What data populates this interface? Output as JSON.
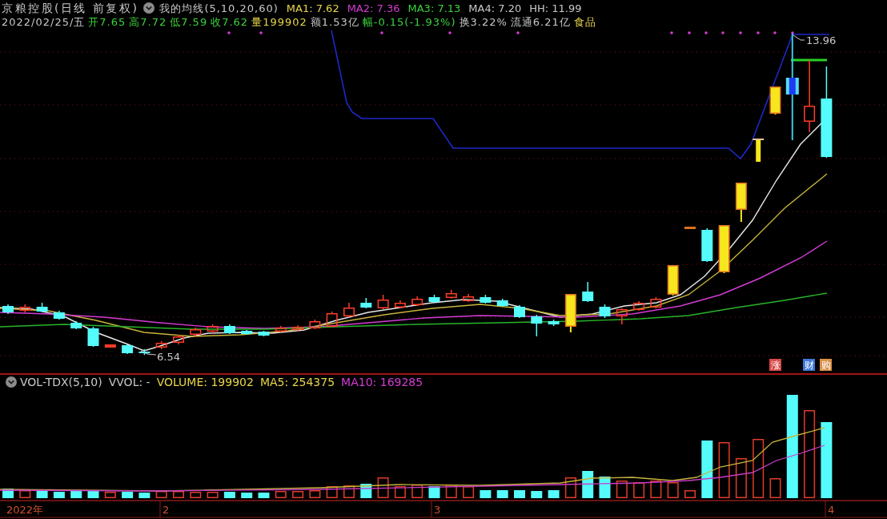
{
  "header": {
    "title": "京粮控股(日线 前复权)",
    "indicator": "我的均线(5,10,20,60)",
    "values": [
      {
        "text": "MA1: 7.62",
        "color": "#e8d64a"
      },
      {
        "text": "MA2: 7.36",
        "color": "#d43cd4"
      },
      {
        "text": "MA3: 7.13",
        "color": "#3cd23c"
      },
      {
        "text": "MA4: 7.20",
        "color": "#c8c8c8"
      },
      {
        "text": "HH: 11.99",
        "color": "#c8c8c8"
      }
    ]
  },
  "quote": {
    "date": "2022/02/25/五",
    "fields": [
      {
        "text": "开7.65",
        "color": "#3cd23c"
      },
      {
        "text": "高7.72",
        "color": "#3cd23c"
      },
      {
        "text": "低7.59",
        "color": "#3cd23c"
      },
      {
        "text": "收7.62",
        "color": "#3cd23c"
      },
      {
        "text": "量199902",
        "color": "#e8d64a"
      },
      {
        "text": "额1.53亿",
        "color": "#c8c8c8"
      },
      {
        "text": "幅-0.15(-1.93%)",
        "color": "#3cd23c"
      },
      {
        "text": "换3.22%",
        "color": "#c8c8c8"
      },
      {
        "text": "流通6.21亿",
        "color": "#c8c8c8"
      },
      {
        "text": "食品",
        "color": "#e8d64a"
      }
    ]
  },
  "price_chart": {
    "high_label": "13.96",
    "low_label": "6.54",
    "markers": [
      {
        "text": "涨",
        "color": "#d84848"
      },
      {
        "text": "财",
        "color": "#3c78d8"
      },
      {
        "text": "购",
        "color": "#d89048"
      }
    ]
  },
  "volume_panel": {
    "indicator": "VOL-TDX(5,10)",
    "values": [
      {
        "text": "VVOL: -",
        "color": "#c8c8c8"
      },
      {
        "text": "VOLUME: 199902",
        "color": "#e8d64a"
      },
      {
        "text": "MA5: 254375",
        "color": "#e8d64a"
      },
      {
        "text": "MA10: 169285",
        "color": "#d43cd4"
      }
    ]
  },
  "time_axis": [
    {
      "label": "2022年"
    },
    {
      "label": "2"
    },
    {
      "label": "3"
    },
    {
      "label": "4"
    }
  ]
}
